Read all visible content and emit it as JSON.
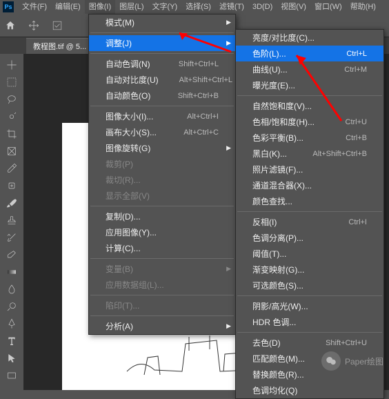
{
  "app": {
    "logo": "Ps"
  },
  "menubar": [
    "文件(F)",
    "编辑(E)",
    "图像(I)",
    "图层(L)",
    "文字(Y)",
    "选择(S)",
    "滤镜(T)",
    "3D(D)",
    "视图(V)",
    "窗口(W)",
    "帮助(H)"
  ],
  "doc_tab": "教程图.tif @ 5...",
  "menu1": {
    "items": [
      {
        "label": "模式(M)",
        "sub": true
      },
      {
        "sep": true
      },
      {
        "label": "调整(J)",
        "sub": true,
        "hl": true
      },
      {
        "sep": true
      },
      {
        "label": "自动色调(N)",
        "sc": "Shift+Ctrl+L"
      },
      {
        "label": "自动对比度(U)",
        "sc": "Alt+Shift+Ctrl+L"
      },
      {
        "label": "自动颜色(O)",
        "sc": "Shift+Ctrl+B"
      },
      {
        "sep": true
      },
      {
        "label": "图像大小(I)...",
        "sc": "Alt+Ctrl+I"
      },
      {
        "label": "画布大小(S)...",
        "sc": "Alt+Ctrl+C"
      },
      {
        "label": "图像旋转(G)",
        "sub": true
      },
      {
        "label": "裁剪(P)",
        "dis": true
      },
      {
        "label": "裁切(R)...",
        "dis": true
      },
      {
        "label": "显示全部(V)",
        "dis": true
      },
      {
        "sep": true
      },
      {
        "label": "复制(D)..."
      },
      {
        "label": "应用图像(Y)..."
      },
      {
        "label": "计算(C)..."
      },
      {
        "sep": true
      },
      {
        "label": "变量(B)",
        "sub": true,
        "dis": true
      },
      {
        "label": "应用数据组(L)...",
        "dis": true
      },
      {
        "sep": true
      },
      {
        "label": "陷印(T)...",
        "dis": true
      },
      {
        "sep": true
      },
      {
        "label": "分析(A)",
        "sub": true
      }
    ]
  },
  "menu2": {
    "items": [
      {
        "label": "亮度/对比度(C)..."
      },
      {
        "label": "色阶(L)...",
        "sc": "Ctrl+L",
        "hl": true
      },
      {
        "label": "曲线(U)...",
        "sc": "Ctrl+M"
      },
      {
        "label": "曝光度(E)..."
      },
      {
        "sep": true
      },
      {
        "label": "自然饱和度(V)..."
      },
      {
        "label": "色相/饱和度(H)...",
        "sc": "Ctrl+U"
      },
      {
        "label": "色彩平衡(B)...",
        "sc": "Ctrl+B"
      },
      {
        "label": "黑白(K)...",
        "sc": "Alt+Shift+Ctrl+B"
      },
      {
        "label": "照片滤镜(F)..."
      },
      {
        "label": "通道混合器(X)..."
      },
      {
        "label": "颜色查找..."
      },
      {
        "sep": true
      },
      {
        "label": "反相(I)",
        "sc": "Ctrl+I"
      },
      {
        "label": "色调分离(P)..."
      },
      {
        "label": "阈值(T)..."
      },
      {
        "label": "渐变映射(G)..."
      },
      {
        "label": "可选颜色(S)..."
      },
      {
        "sep": true
      },
      {
        "label": "阴影/高光(W)..."
      },
      {
        "label": "HDR 色调..."
      },
      {
        "sep": true
      },
      {
        "label": "去色(D)",
        "sc": "Shift+Ctrl+U"
      },
      {
        "label": "匹配颜色(M)..."
      },
      {
        "label": "替换颜色(R)..."
      },
      {
        "label": "色调均化(Q)"
      }
    ]
  },
  "watermark": "Paper绘图"
}
